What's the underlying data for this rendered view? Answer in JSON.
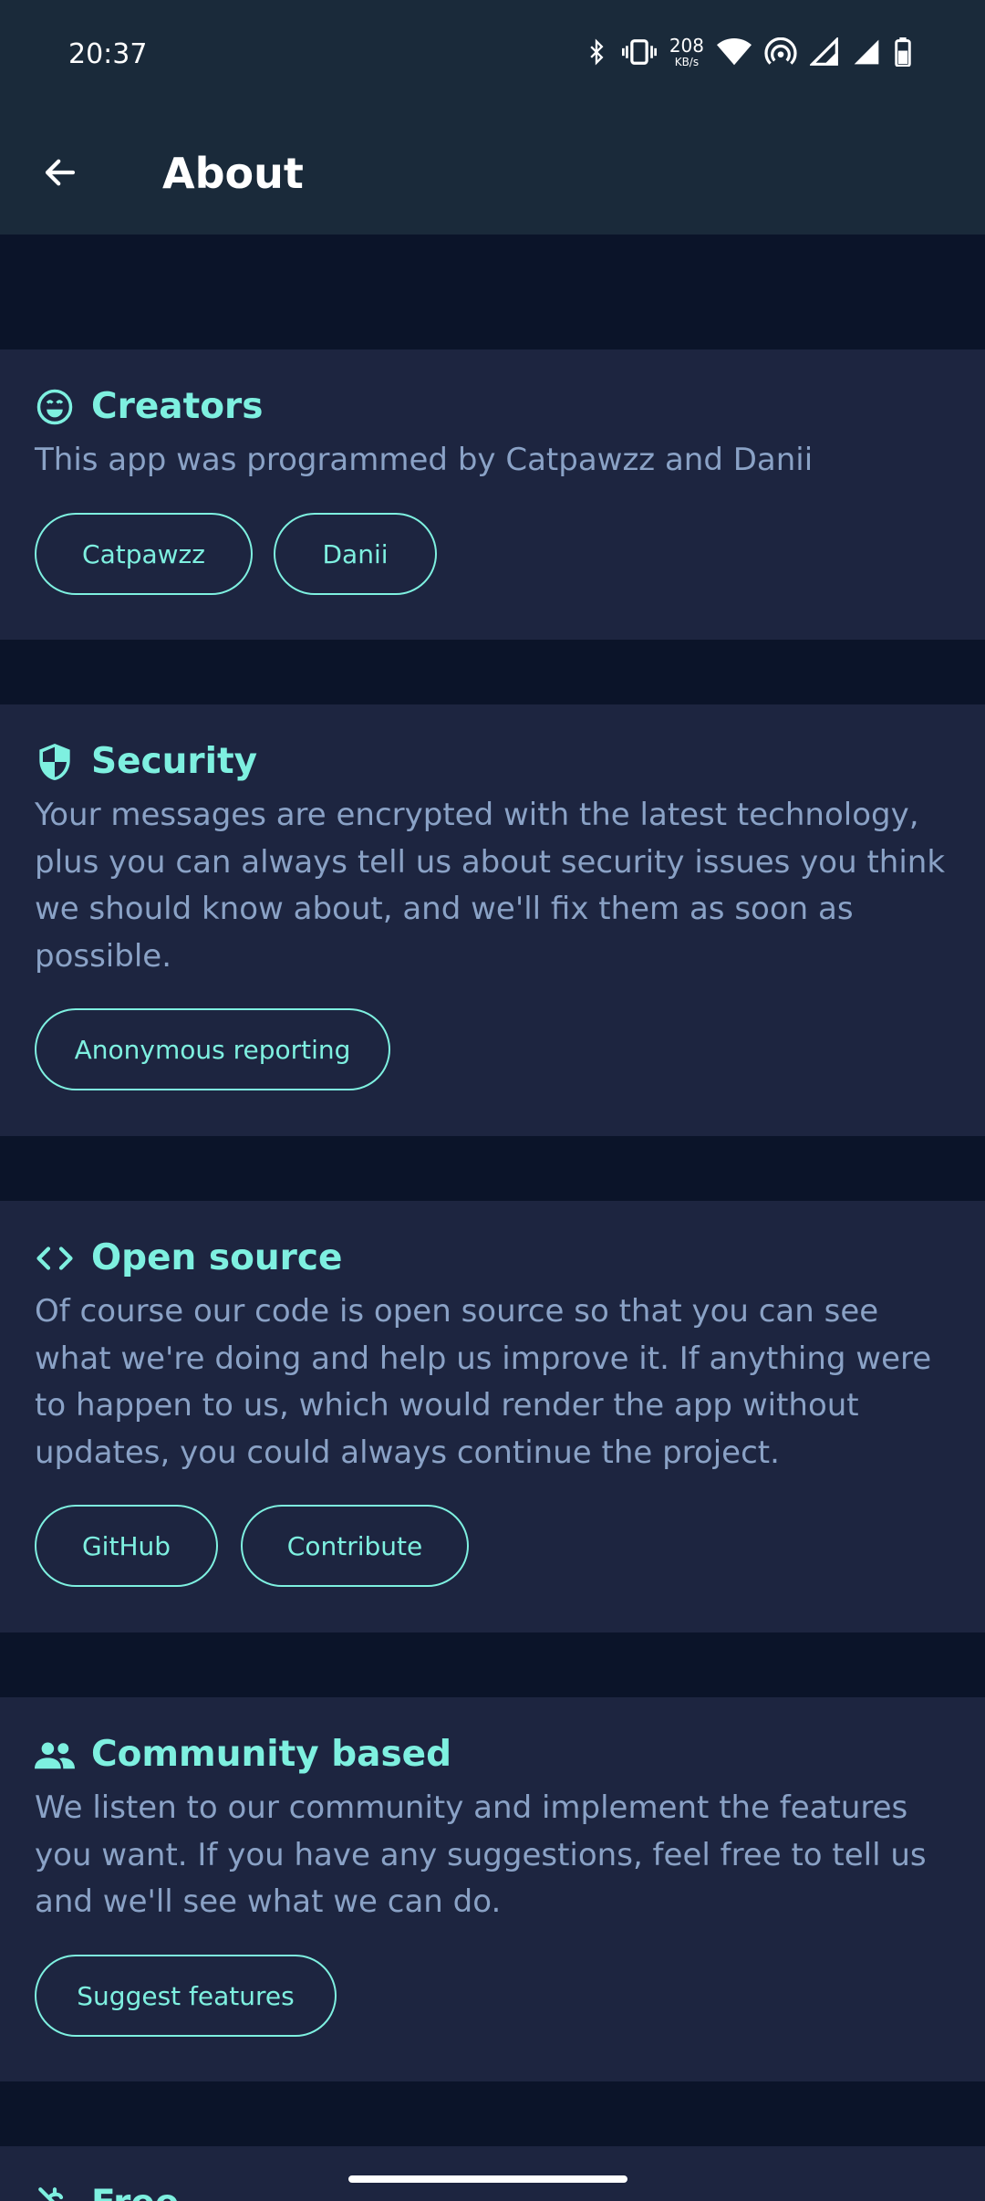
{
  "status_bar": {
    "time": "20:37",
    "net_speed_value": "208",
    "net_speed_unit": "KB/s",
    "icons": [
      "bluetooth-icon",
      "vibrate-icon",
      "wifi-icon",
      "hotspot-icon",
      "signal-icon",
      "signal-icon",
      "battery-icon"
    ]
  },
  "app_bar": {
    "title": "About",
    "back_icon": "arrow-back-icon"
  },
  "colors": {
    "accent": "#7ef0e0",
    "body_text": "#8aa2c6",
    "card_bg": "#1d2540",
    "page_bg": "#0b1429",
    "bar_bg": "#1a2a3a"
  },
  "sections": [
    {
      "icon": "smiley-icon",
      "title": "Creators",
      "body": "This app was programmed by Catpawzz and Danii",
      "buttons": [
        "Catpawzz",
        "Danii"
      ]
    },
    {
      "icon": "shield-icon",
      "title": "Security",
      "body": "Your messages are encrypted with the latest technology, plus you can always tell us about security issues you think we should know about, and we'll fix them as soon as possible.",
      "buttons": [
        "Anonymous reporting"
      ]
    },
    {
      "icon": "code-icon",
      "title": "Open source",
      "body": "Of course our code is open source so that you can see what we're doing and help us improve it. If anything were to happen to us, which would render the app without updates, you could always continue the project.",
      "buttons": [
        "GitHub",
        "Contribute"
      ]
    },
    {
      "icon": "people-icon",
      "title": "Community based",
      "body": "We listen to our community and implement the features you want. If you have any suggestions, feel free to tell us and we'll see what we can do.",
      "buttons": [
        "Suggest features"
      ]
    },
    {
      "icon": "money-off-icon",
      "title": "Free",
      "body": "",
      "buttons": []
    }
  ]
}
